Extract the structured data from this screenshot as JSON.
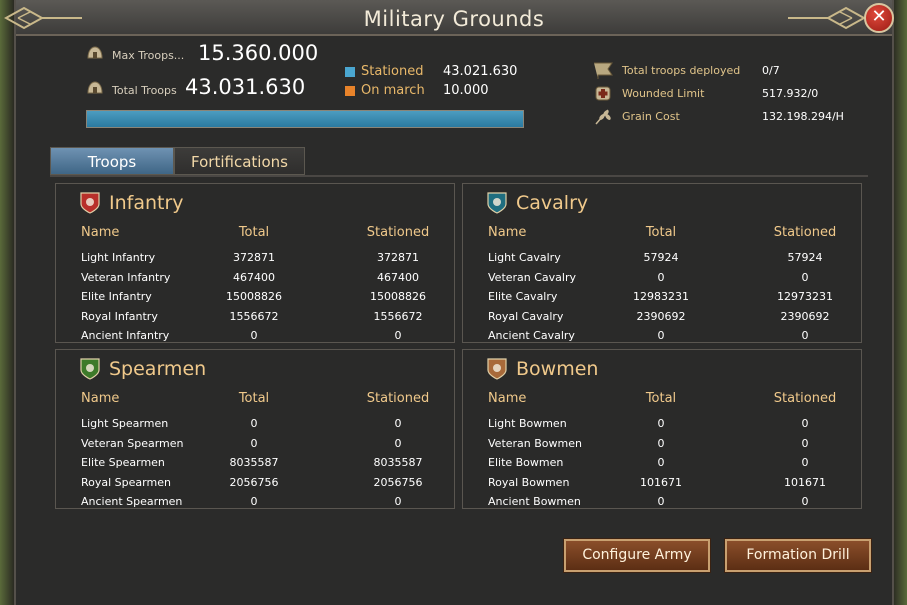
{
  "window": {
    "title": "Military Grounds",
    "close_glyph": "✕"
  },
  "summary": {
    "max_troops_label": "Max Troops...",
    "max_troops_value": "15.360.000",
    "total_troops_label": "Total Troops",
    "total_troops_value": "43.031.630",
    "stationed_label": "Stationed",
    "stationed_value": "43.021.630",
    "on_march_label": "On march",
    "on_march_value": "10.000",
    "stationed_color": "#4aa6d0",
    "on_march_color": "#e8832a",
    "progress_fraction": 1.0
  },
  "right_stats": {
    "deployed_label": "Total troops deployed",
    "deployed_value": "0/7",
    "wounded_label": "Wounded Limit",
    "wounded_value": "517.932/0",
    "grain_label": "Grain Cost",
    "grain_value": "132.198.294/H"
  },
  "tabs": {
    "troops": "Troops",
    "fortifications": "Fortifications"
  },
  "columns": {
    "name": "Name",
    "total": "Total",
    "stationed": "Stationed"
  },
  "panels": {
    "infantry": {
      "title": "Infantry",
      "color": "#b8302a",
      "rows": [
        {
          "name": "Light Infantry",
          "total": "372871",
          "stationed": "372871"
        },
        {
          "name": "Veteran Infantry",
          "total": "467400",
          "stationed": "467400"
        },
        {
          "name": "Elite Infantry",
          "total": "15008826",
          "stationed": "15008826"
        },
        {
          "name": "Royal Infantry",
          "total": "1556672",
          "stationed": "1556672"
        },
        {
          "name": "Ancient Infantry",
          "total": "0",
          "stationed": "0"
        }
      ]
    },
    "cavalry": {
      "title": "Cavalry",
      "color": "#1f6e80",
      "rows": [
        {
          "name": "Light Cavalry",
          "total": "57924",
          "stationed": "57924"
        },
        {
          "name": "Veteran Cavalry",
          "total": "0",
          "stationed": "0"
        },
        {
          "name": "Elite Cavalry",
          "total": "12983231",
          "stationed": "12973231"
        },
        {
          "name": "Royal Cavalry",
          "total": "2390692",
          "stationed": "2390692"
        },
        {
          "name": "Ancient Cavalry",
          "total": "0",
          "stationed": "0"
        }
      ]
    },
    "spearmen": {
      "title": "Spearmen",
      "color": "#3d7a2a",
      "rows": [
        {
          "name": "Light Spearmen",
          "total": "0",
          "stationed": "0"
        },
        {
          "name": "Veteran Spearmen",
          "total": "0",
          "stationed": "0"
        },
        {
          "name": "Elite Spearmen",
          "total": "8035587",
          "stationed": "8035587"
        },
        {
          "name": "Royal Spearmen",
          "total": "2056756",
          "stationed": "2056756"
        },
        {
          "name": "Ancient Spearmen",
          "total": "0",
          "stationed": "0"
        }
      ]
    },
    "bowmen": {
      "title": "Bowmen",
      "color": "#a86a3a",
      "rows": [
        {
          "name": "Light Bowmen",
          "total": "0",
          "stationed": "0"
        },
        {
          "name": "Veteran Bowmen",
          "total": "0",
          "stationed": "0"
        },
        {
          "name": "Elite Bowmen",
          "total": "0",
          "stationed": "0"
        },
        {
          "name": "Royal Bowmen",
          "total": "101671",
          "stationed": "101671"
        },
        {
          "name": "Ancient Bowmen",
          "total": "0",
          "stationed": "0"
        }
      ]
    }
  },
  "buttons": {
    "configure_army": "Configure Army",
    "formation_drill": "Formation Drill"
  }
}
